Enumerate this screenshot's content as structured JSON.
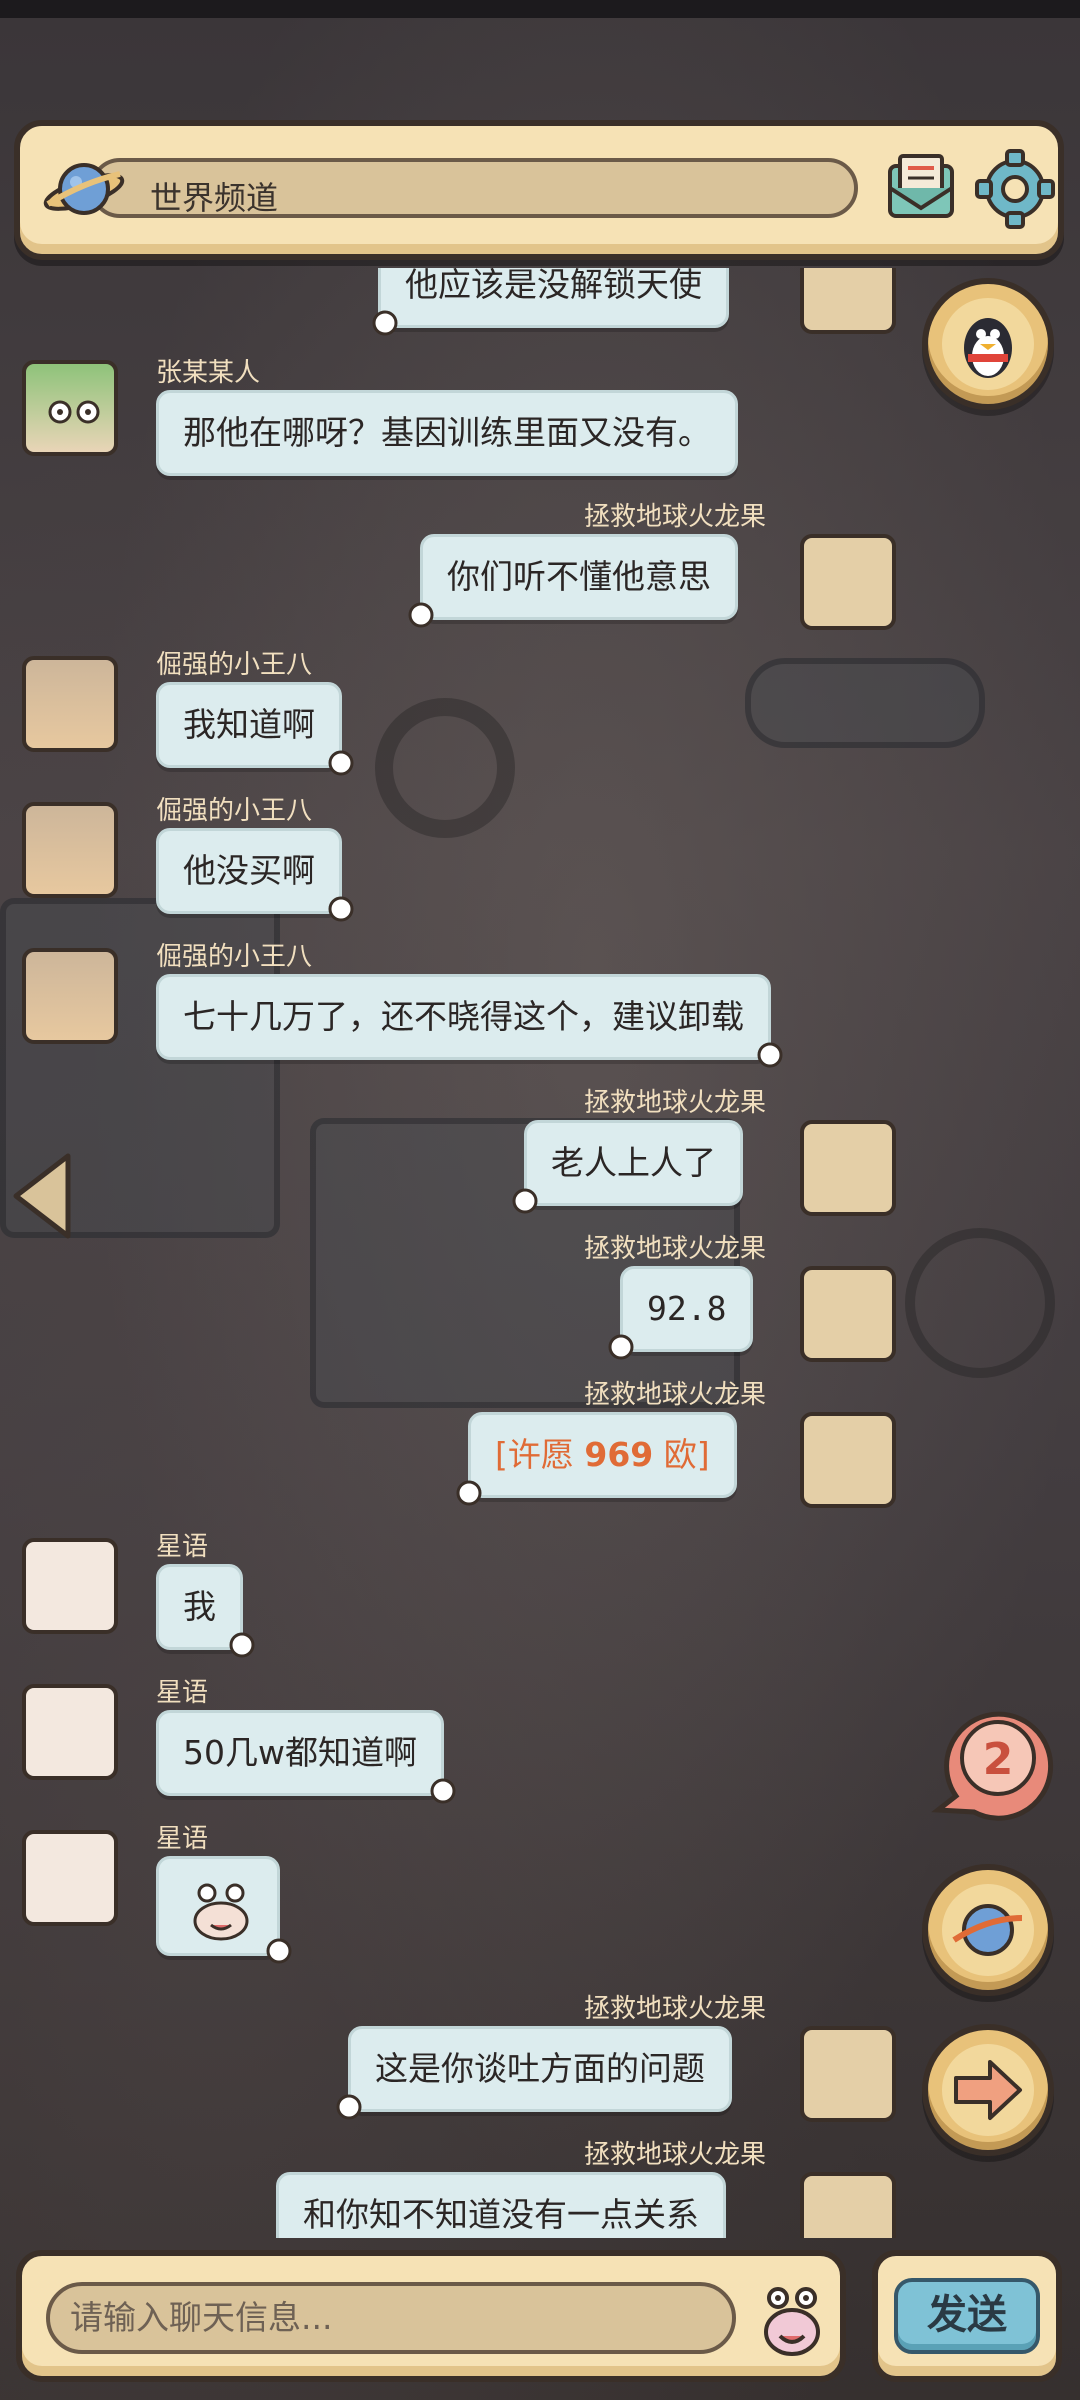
{
  "header": {
    "channel_title": "世界频道",
    "icons": [
      "planet-icon",
      "mail-icon",
      "gear-icon"
    ]
  },
  "messages": [
    {
      "sender": "",
      "text": "他应该是没解锁天使",
      "side": "right"
    },
    {
      "sender": "张某某人",
      "text": "那他在哪呀？基因训练里面又没有。",
      "side": "left"
    },
    {
      "sender": "拯救地球火龙果",
      "text": "你们听不懂他意思",
      "side": "right"
    },
    {
      "sender": "倔强的小王八",
      "text": "我知道啊",
      "side": "left"
    },
    {
      "sender": "倔强的小王八",
      "text": "他没买啊",
      "side": "left"
    },
    {
      "sender": "倔强的小王八",
      "text": "七十几万了，还不晓得这个，建议卸载",
      "side": "left"
    },
    {
      "sender": "拯救地球火龙果",
      "text": "老人上人了",
      "side": "right"
    },
    {
      "sender": "拯救地球火龙果",
      "text": "92.8",
      "side": "right"
    },
    {
      "sender": "拯救地球火龙果",
      "wish_prefix": "[许愿 ",
      "wish_value": "969",
      "wish_suffix": " 欧]",
      "side": "right"
    },
    {
      "sender": "星语",
      "text": "我",
      "side": "left"
    },
    {
      "sender": "星语",
      "text": "50几w都知道啊",
      "side": "left"
    },
    {
      "sender": "星语",
      "sticker": "crab-emoji-icon",
      "side": "left"
    },
    {
      "sender": "拯救地球火龙果",
      "text": "这是你谈吐方面的问题",
      "side": "right"
    },
    {
      "sender": "拯救地球火龙果",
      "text": "和你知不知道没有一点关系",
      "side": "right"
    }
  ],
  "side_buttons": {
    "badge_count": "2",
    "icons": [
      "qq-penguin-icon",
      "notification-badge",
      "planet-icon",
      "arrow-right-icon",
      "arrow-left-icon"
    ]
  },
  "footer": {
    "input_placeholder": "请输入聊天信息...",
    "send_label": "发送",
    "emoji_icon": "crab-emoji-icon"
  },
  "colors": {
    "bubble": "#dcecee",
    "frame": "#f6e2b5",
    "send": "#7fc2d6",
    "wish": "#e06b36",
    "sender_name": "#f1dfbf"
  }
}
